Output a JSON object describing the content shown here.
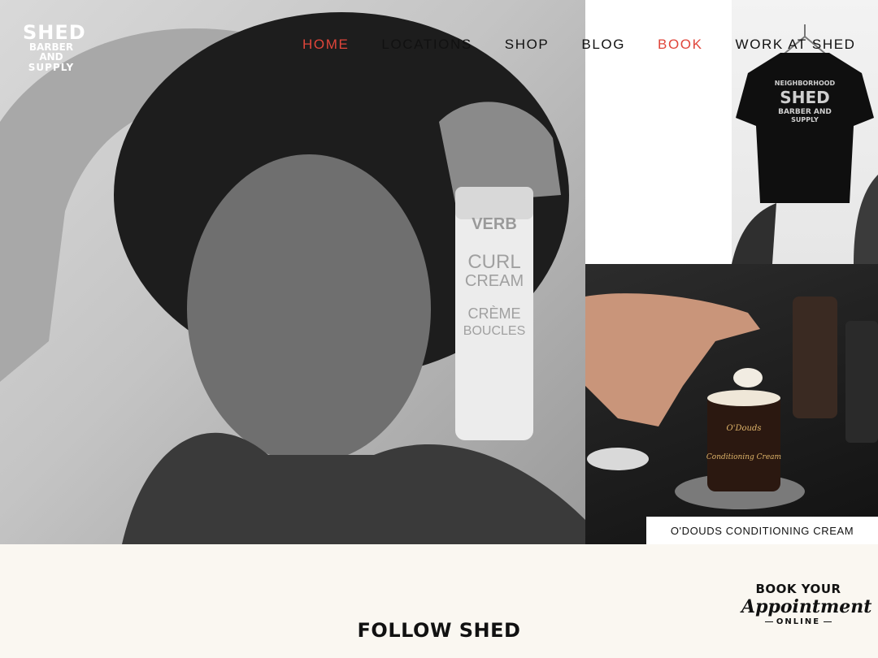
{
  "brand": {
    "logo_line1": "SHED",
    "logo_line2": "BARBER",
    "logo_line3": "AND",
    "logo_line4": "SUPPLY"
  },
  "nav": {
    "items": [
      {
        "label": "HOME",
        "state": "active"
      },
      {
        "label": "LOCATIONS",
        "state": "normal"
      },
      {
        "label": "SHOP",
        "state": "normal"
      },
      {
        "label": "BLOG",
        "state": "normal"
      },
      {
        "label": "BOOK",
        "state": "highlight"
      },
      {
        "label": "WORK AT SHED",
        "state": "normal"
      }
    ]
  },
  "hero": {
    "product_tube_text_1": "VERB",
    "product_tube_text_2": "CURL",
    "product_tube_text_3": "CREAM",
    "product_tube_text_4": "CRÈME",
    "product_tube_text_5": "BOUCLES"
  },
  "tshirt": {
    "print_line1": "NEIGHBORHOOD",
    "print_line2": "SHED",
    "print_line3": "BARBER AND",
    "print_line4": "SUPPLY"
  },
  "product": {
    "jar_brand": "O'Douds",
    "jar_name": "Conditioning Cream",
    "caption": "O'DOUDS CONDITIONING CREAM"
  },
  "follow": {
    "heading": "FOLLOW SHED"
  },
  "book_badge": {
    "line1": "BOOK YOUR",
    "line2": "Appointment",
    "line3": "ONLINE"
  },
  "colors": {
    "accent": "#e0453a",
    "background": "#faf7f1",
    "text": "#111111"
  }
}
